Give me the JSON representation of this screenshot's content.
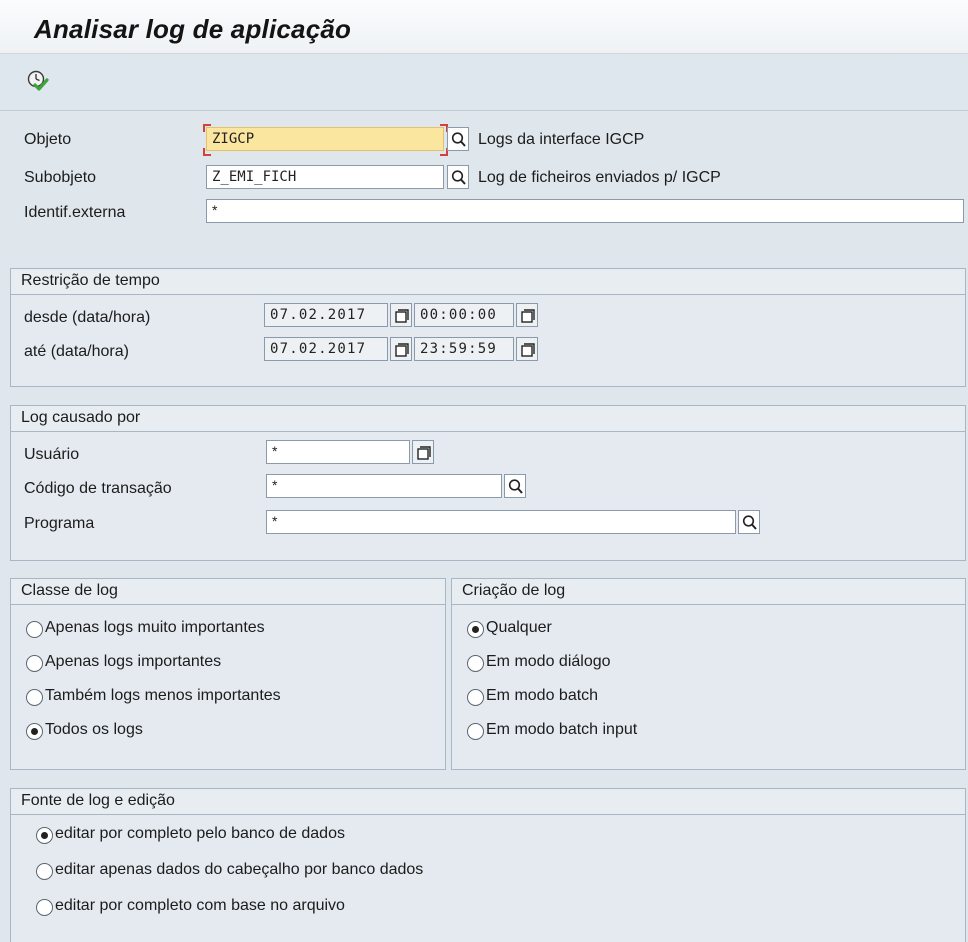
{
  "title": "Analisar log de aplicação",
  "toolbar": {
    "execute_icon": "execute-clock-check-icon"
  },
  "header_fields": {
    "objeto": {
      "label": "Objeto",
      "value": "ZIGCP",
      "description": "Logs da interface IGCP"
    },
    "subobjeto": {
      "label": "Subobjeto",
      "value": "Z_EMI_FICH",
      "description": "Log de ficheiros enviados p/ IGCP"
    },
    "identif_externa": {
      "label": "Identif.externa",
      "value": "*"
    }
  },
  "time_restriction": {
    "title": "Restrição de tempo",
    "from": {
      "label": "desde (data/hora)",
      "date": "07.02.2017",
      "time": "00:00:00"
    },
    "to": {
      "label": "até (data/hora)",
      "date": "07.02.2017",
      "time": "23:59:59"
    }
  },
  "caused_by": {
    "title": "Log causado por",
    "usuario": {
      "label": "Usuário",
      "value": "*"
    },
    "codigo_transacao": {
      "label": "Código de transação",
      "value": "*"
    },
    "programa": {
      "label": "Programa",
      "value": "*"
    }
  },
  "log_class": {
    "title": "Classe de log",
    "options": [
      {
        "label": "Apenas logs muito importantes",
        "checked": false
      },
      {
        "label": "Apenas logs importantes",
        "checked": false
      },
      {
        "label": "Também logs menos importantes",
        "checked": false
      },
      {
        "label": "Todos os logs",
        "checked": true
      }
    ]
  },
  "log_creation": {
    "title": "Criação de log",
    "options": [
      {
        "label": "Qualquer",
        "checked": true
      },
      {
        "label": "Em modo diálogo",
        "checked": false
      },
      {
        "label": "Em modo batch",
        "checked": false
      },
      {
        "label": "Em modo batch input",
        "checked": false
      }
    ]
  },
  "log_source": {
    "title": "Fonte de log e edição",
    "options": [
      {
        "label": "editar por completo pelo banco de dados",
        "checked": true
      },
      {
        "label": "editar apenas dados do cabeçalho por banco dados",
        "checked": false
      },
      {
        "label": "editar por completo com base no arquivo",
        "checked": false
      }
    ]
  },
  "colors": {
    "focus_field": "#fbe69f",
    "background": "#dfe6ec",
    "group_border": "#a9b6c3"
  }
}
